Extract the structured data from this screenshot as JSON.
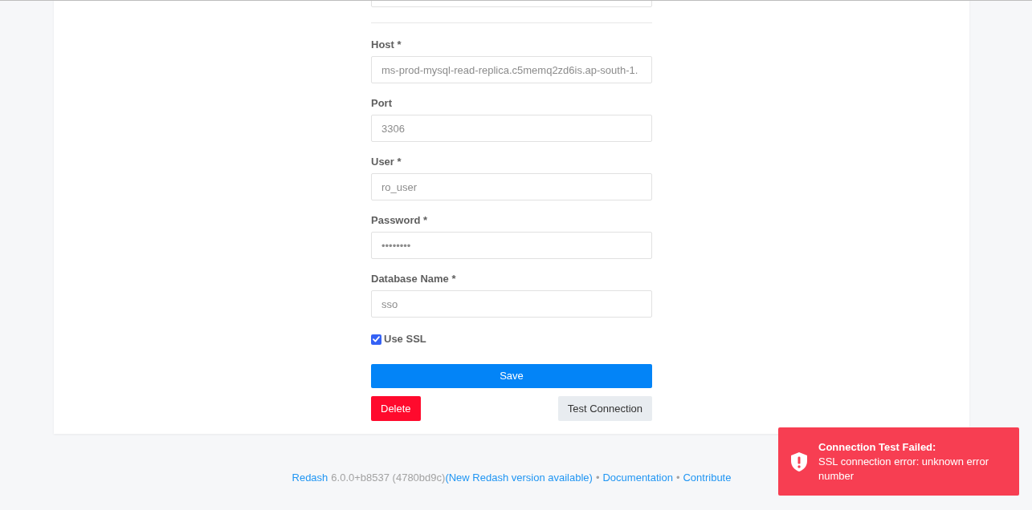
{
  "form": {
    "fields": [
      {
        "kind": "text"
      },
      {
        "kind": "text",
        "label": "Host *",
        "value": "ms-prod-mysql-read-replica.c5memq2zd6is.ap-south-1."
      },
      {
        "kind": "text",
        "label": "Port",
        "value": "3306"
      },
      {
        "kind": "text",
        "label": "User *",
        "value": "ro_user"
      },
      {
        "kind": "text",
        "label": "Password *",
        "value": "••••••••"
      },
      {
        "kind": "text",
        "label": "Database Name *",
        "value": "sso"
      }
    ],
    "checkbox": {
      "label": "Use SSL",
      "checked": true
    },
    "buttons": [
      {
        "kind": "primary",
        "label": "Save"
      },
      {
        "kind": "danger",
        "label": "Delete"
      },
      {
        "kind": "secondary",
        "label": "Test Connection"
      }
    ]
  },
  "toast": {
    "kind": "error",
    "title": "Connection Test Failed:",
    "message": "SSL connection error: unknown error number"
  },
  "footer": {
    "parts": [
      {
        "kind": "link",
        "text": "Redash"
      },
      {
        "kind": "version",
        "text": "6.0.0+b8537 (4780bd9c)"
      },
      {
        "kind": "link",
        "text": "(New Redash version available)"
      },
      {
        "kind": "separator",
        "text": "•"
      },
      {
        "kind": "link",
        "text": "Documentation"
      },
      {
        "kind": "separator",
        "text": "•"
      },
      {
        "kind": "link",
        "text": "Contribute"
      }
    ]
  }
}
